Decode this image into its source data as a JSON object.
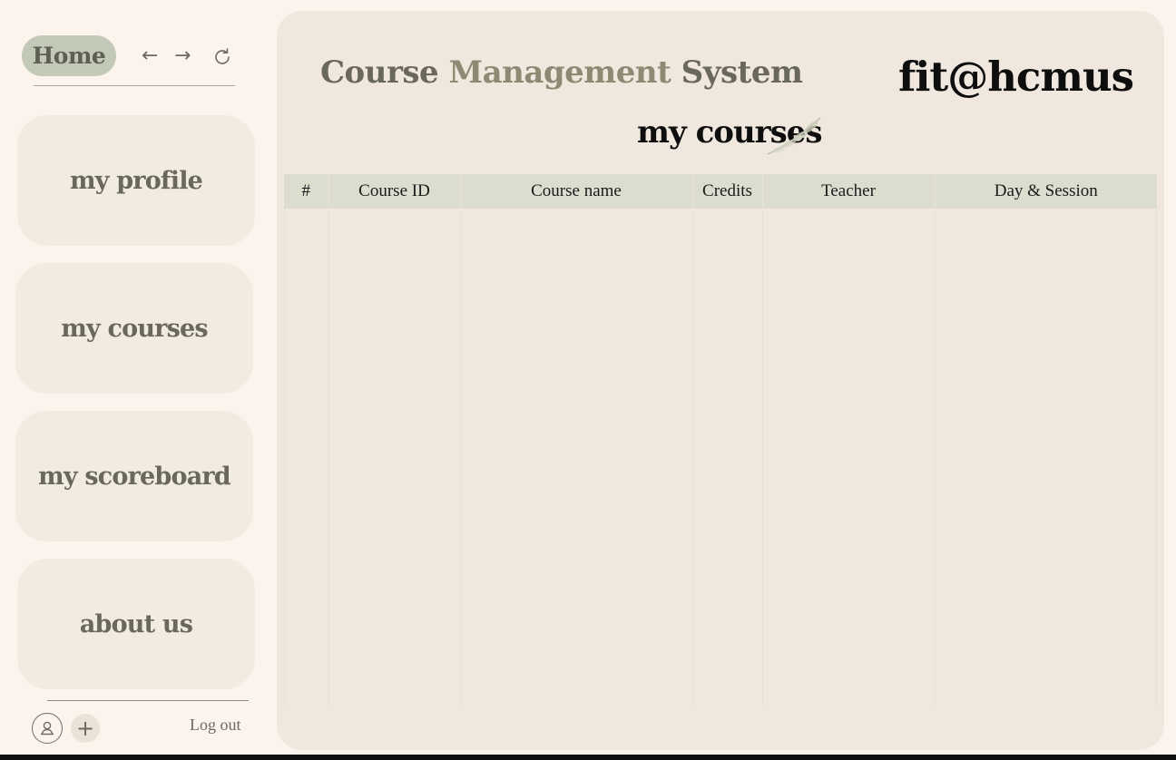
{
  "sidebar": {
    "home_label": "Home",
    "nav": {
      "back_icon": "arrow-left-icon",
      "forward_icon": "arrow-right-icon",
      "reload_icon": "reload-icon"
    },
    "menu": [
      {
        "label": "my profile"
      },
      {
        "label": "my courses"
      },
      {
        "label": "my scoreboard"
      },
      {
        "label": "about us"
      }
    ],
    "footer": {
      "user_icon": "user-icon",
      "add_icon": "plus-icon",
      "logout_label": "Log out"
    }
  },
  "header": {
    "app_title_part1": "Course ",
    "app_title_accent": "Management",
    "app_title_part2": " System",
    "brand": "fit@hcmus"
  },
  "main": {
    "section_title": "my courses",
    "table": {
      "columns": [
        "#",
        "Course ID",
        "Course name",
        "Credits",
        "Teacher",
        "Day & Session"
      ],
      "rows": []
    }
  },
  "colors": {
    "background": "#fcf4ec",
    "panel": "#f0e8df",
    "card": "#f2ebe1",
    "home_button": "#c2c9b6",
    "table_header": "#dcdccf"
  }
}
